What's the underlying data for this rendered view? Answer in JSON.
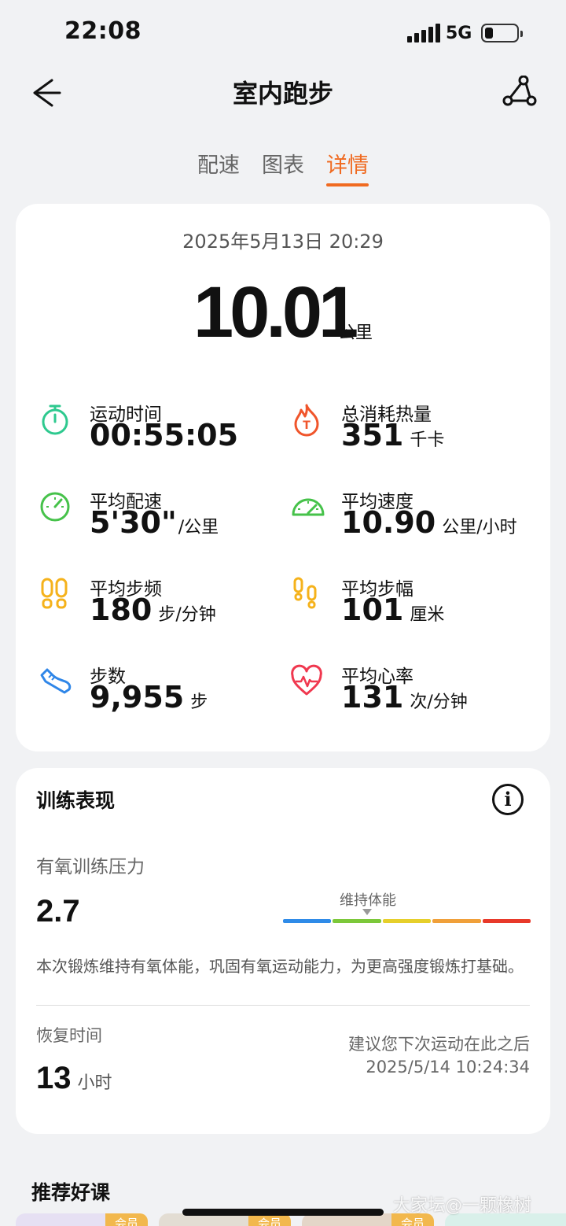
{
  "status_bar": {
    "time": "22:08",
    "network": "5G"
  },
  "header": {
    "title": "室内跑步"
  },
  "tabs": [
    {
      "label": "配速",
      "active": false
    },
    {
      "label": "图表",
      "active": false
    },
    {
      "label": "详情",
      "active": true
    }
  ],
  "summary": {
    "datetime": "2025年5月13日 20:29",
    "distance": "10.01",
    "distance_unit": "公里",
    "metrics": [
      {
        "label": "运动时间",
        "value": "00:55:05",
        "unit": "",
        "icon": "stopwatch-icon",
        "color": "#2ec98f"
      },
      {
        "label": "总消耗热量",
        "value": "351",
        "unit": "千卡",
        "icon": "flame-icon",
        "color": "#f0552b"
      },
      {
        "label": "平均配速",
        "value": "5'30\"",
        "unit": "/公里",
        "icon": "pace-gauge-icon",
        "color": "#46c24a"
      },
      {
        "label": "平均速度",
        "value": "10.90",
        "unit": "公里/小时",
        "icon": "speedometer-icon",
        "color": "#46c24a"
      },
      {
        "label": "平均步频",
        "value": "180",
        "unit": "步/分钟",
        "icon": "footprints-icon",
        "color": "#f5b21b"
      },
      {
        "label": "平均步幅",
        "value": "101",
        "unit": "厘米",
        "icon": "stride-footprints-icon",
        "color": "#f5b21b"
      },
      {
        "label": "步数",
        "value": "9,955",
        "unit": "步",
        "icon": "shoe-icon",
        "color": "#2f86e8"
      },
      {
        "label": "平均心率",
        "value": "131",
        "unit": "次/分钟",
        "icon": "heart-rate-icon",
        "color": "#f0384f"
      }
    ]
  },
  "training": {
    "title": "训练表现",
    "aerobic_label": "有氧训练压力",
    "aerobic_value": "2.7",
    "scale_label": "维持体能",
    "scale_colors": [
      "#2f8be8",
      "#7cc83a",
      "#e6cf2b",
      "#f0a03a",
      "#e8392a"
    ],
    "description": "本次锻炼维持有氧体能，巩固有氧运动能力，为更高强度锻炼打基础。",
    "recovery_label": "恢复时间",
    "recovery_value": "13",
    "recovery_unit": "小时",
    "next_note": "建议您下次运动在此之后",
    "next_time": "2025/5/14 10:24:34"
  },
  "recommend": {
    "title": "推荐好课",
    "badge": "会员"
  },
  "watermark": "大家坛@一颗橡树"
}
